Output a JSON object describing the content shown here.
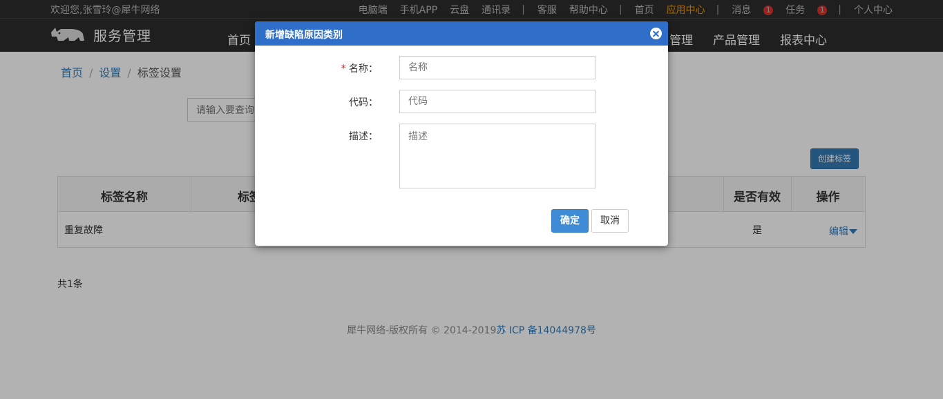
{
  "topbar": {
    "welcome": "欢迎您,张雪玲@犀牛网络",
    "links": [
      "电脑端",
      "手机APP",
      "云盘",
      "通讯录"
    ],
    "links2": [
      "客服",
      "帮助中心"
    ],
    "home": "首页",
    "app_center": "应用中心",
    "messages": "消息",
    "messages_count": "1",
    "tasks": "任务",
    "tasks_count": "1",
    "personal": "个人中心",
    "separator": "|"
  },
  "header": {
    "logo_text": "服务管理",
    "nav": [
      "首页",
      "管理",
      "产品管理",
      "报表中心"
    ]
  },
  "breadcrumb": [
    "首页",
    "设置",
    "标签设置"
  ],
  "breadcrumb_sep": "/",
  "search": {
    "placeholder": "请输入要查询"
  },
  "create_button": "创建标签",
  "table": {
    "headers": [
      "标签名称",
      "标签",
      "是否有效",
      "操作"
    ],
    "rows": [
      {
        "name": "重复故障",
        "valid": "是",
        "action": "编辑"
      }
    ]
  },
  "total": "共1条",
  "footer": {
    "text": "犀牛网络-版权所有 © 2014-2019",
    "icp": "苏 ICP 备14044978号"
  },
  "modal": {
    "title": "新增缺陷原因类别",
    "fields": [
      {
        "label": "名称：",
        "required": "*",
        "placeholder": "名称"
      },
      {
        "label": "代码：",
        "placeholder": "代码"
      },
      {
        "label": "描述：",
        "placeholder": "描述"
      }
    ],
    "ok": "确定",
    "cancel": "取消"
  },
  "colors": {
    "modal_header": "#2f6fc9",
    "primary": "#337ab7",
    "accent": "#f39800",
    "badge": "#d9342b",
    "topbar": "#2d2d2d"
  }
}
